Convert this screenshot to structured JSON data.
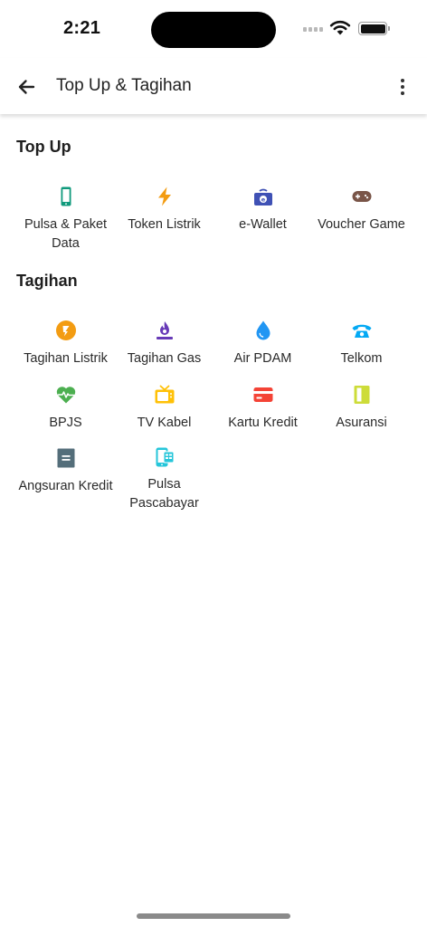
{
  "status_bar": {
    "time": "2:21"
  },
  "app_bar": {
    "title": "Top Up & Tagihan"
  },
  "sections": {
    "topup": {
      "title": "Top Up",
      "items": [
        {
          "label": "Pulsa & Paket Data",
          "icon": "smartphone-icon",
          "color": "#109A7C"
        },
        {
          "label": "Token Listrik",
          "icon": "lightning-icon",
          "color": "#F39C12"
        },
        {
          "label": "e-Wallet",
          "icon": "wallet-icon",
          "color": "#3F51B5"
        },
        {
          "label": "Voucher Game",
          "icon": "gamepad-icon",
          "color": "#795548"
        }
      ]
    },
    "tagihan": {
      "title": "Tagihan",
      "items": [
        {
          "label": "Tagihan Listrik",
          "icon": "electric-bill-icon",
          "color": "#F39C12"
        },
        {
          "label": "Tagihan Gas",
          "icon": "gas-flame-icon",
          "color": "#673AB7"
        },
        {
          "label": "Air PDAM",
          "icon": "water-drop-icon",
          "color": "#2196F3"
        },
        {
          "label": "Telkom",
          "icon": "telephone-icon",
          "color": "#03A9F4"
        },
        {
          "label": "BPJS",
          "icon": "health-heart-icon",
          "color": "#4CAF50"
        },
        {
          "label": "TV Kabel",
          "icon": "tv-icon",
          "color": "#FFC107"
        },
        {
          "label": "Kartu Kredit",
          "icon": "credit-card-icon",
          "color": "#F44336"
        },
        {
          "label": "Asuransi",
          "icon": "insurance-icon",
          "color": "#CDDC39"
        },
        {
          "label": "Angsuran Kredit",
          "icon": "installment-icon",
          "color": "#546E7A"
        },
        {
          "label": "Pulsa Pascabayar",
          "icon": "postpaid-phone-icon",
          "color": "#26C6DA"
        }
      ]
    }
  }
}
